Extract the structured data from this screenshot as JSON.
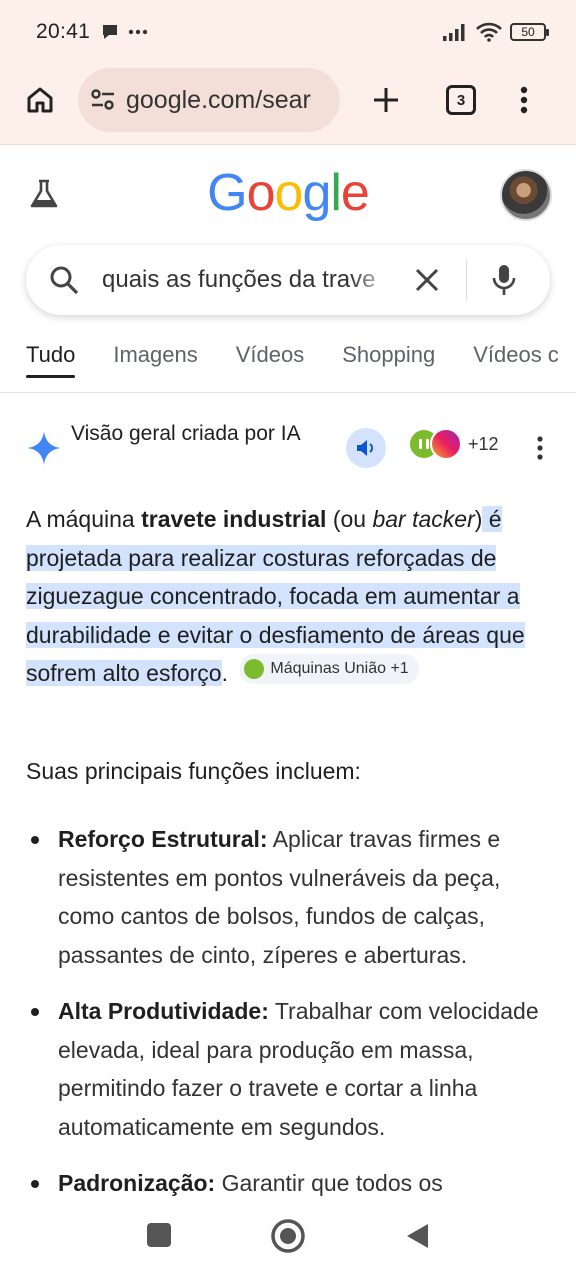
{
  "status_bar": {
    "time": "20:41",
    "battery": "50"
  },
  "browser": {
    "url": "google.com/sear",
    "tab_count": "3"
  },
  "google": {
    "logo_letters": [
      "G",
      "o",
      "o",
      "g",
      "l",
      "e"
    ],
    "query": "quais as funções da trave"
  },
  "search_tabs": [
    {
      "label": "Tudo",
      "active": true
    },
    {
      "label": "Imagens"
    },
    {
      "label": "Vídeos"
    },
    {
      "label": "Shopping"
    },
    {
      "label": "Vídeos c"
    }
  ],
  "ai_overview": {
    "title": "Visão geral criada por IA",
    "source_more": "+12",
    "p1_lead": "A máquina ",
    "p1_bold": "travete industrial",
    "p1_mid": " (ou ",
    "p1_italic": "bar tacker",
    "p1_close": ")",
    "p1_highlight_a": " é",
    "p1_highlight_b": "projetada para realizar costuras reforçadas de ziguezague concentrado, focada em aumentar a durabilidade e evitar o desfiamento de áreas que sofrem alto esforço",
    "p1_end": ".",
    "chip_label": "Máquinas União +1",
    "intro": "Suas principais funções incluem:",
    "bullets": [
      {
        "title": "Reforço Estrutural:",
        "text": " Aplicar travas firmes e resistentes em pontos vulneráveis da peça, como cantos de bolsos, fundos de calças, passantes de cinto, zíperes e aberturas."
      },
      {
        "title": "Alta Produtividade:",
        "text": " Trabalhar com velocidade elevada, ideal para produção em massa, permitindo fazer o travete e cortar a linha automaticamente em segundos."
      },
      {
        "title": "Padronização:",
        "text": " Garantir que todos os"
      }
    ]
  },
  "icons": {
    "home": "home-icon",
    "tune": "tune-icon",
    "add": "plus-icon",
    "menu": "more-vert-icon",
    "labs": "flask-icon",
    "search": "search-icon",
    "clear": "close-icon",
    "mic": "mic-icon",
    "sparkle": "sparkle-icon",
    "speaker": "speaker-icon"
  },
  "colors": {
    "chrome_bg": "#fdf0ea",
    "omnibox_bg": "#f3dfd8",
    "highlight": "#d3e3fd",
    "sparkle": "#4285f4"
  }
}
